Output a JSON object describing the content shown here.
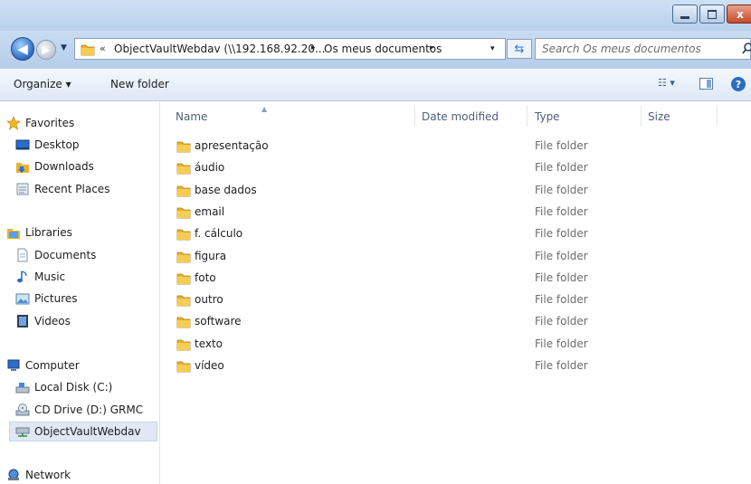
{
  "window": {
    "minimize_icon": "minimize-icon",
    "maximize_icon": "restore-icon",
    "close_label": "x"
  },
  "address": {
    "prefix": "«",
    "crumb_1": "ObjectVaultWebdav (\\\\192.168.92.20...",
    "separator": "▸",
    "crumb_2": "Os meus documentos",
    "dropdown": "▾"
  },
  "search": {
    "placeholder": "Search Os meus documentos"
  },
  "toolbar": {
    "organize_label": "Organize ▾",
    "new_folder_label": "New folder",
    "views_label": "☷ ▾",
    "help_label": "?"
  },
  "nav": {
    "favorites": {
      "label": "Favorites",
      "icon": "star-icon"
    },
    "favorites_items": [
      {
        "label": "Desktop",
        "icon": "desktop-icon"
      },
      {
        "label": "Downloads",
        "icon": "downloads-icon"
      },
      {
        "label": "Recent Places",
        "icon": "recent-places-icon"
      }
    ],
    "libraries": {
      "label": "Libraries",
      "icon": "libraries-icon"
    },
    "libraries_items": [
      {
        "label": "Documents",
        "icon": "documents-icon"
      },
      {
        "label": "Music",
        "icon": "music-icon"
      },
      {
        "label": "Pictures",
        "icon": "pictures-icon"
      },
      {
        "label": "Videos",
        "icon": "videos-icon"
      }
    ],
    "computer": {
      "label": "Computer",
      "icon": "computer-icon"
    },
    "computer_items": [
      {
        "label": "Local Disk (C:)",
        "icon": "local-disk-icon"
      },
      {
        "label": "CD Drive (D:) GRMC",
        "icon": "cd-drive-icon"
      },
      {
        "label": "ObjectVaultWebdav",
        "icon": "network-drive-icon",
        "selected": true
      }
    ],
    "network": {
      "label": "Network",
      "icon": "network-icon"
    }
  },
  "columns": {
    "name": "Name",
    "date_modified": "Date modified",
    "type": "Type",
    "size": "Size"
  },
  "files": [
    {
      "name": "apresentação",
      "type": "File folder"
    },
    {
      "name": "áudio",
      "type": "File folder"
    },
    {
      "name": "base dados",
      "type": "File folder"
    },
    {
      "name": "email",
      "type": "File folder"
    },
    {
      "name": "f. cálculo",
      "type": "File folder"
    },
    {
      "name": "figura",
      "type": "File folder"
    },
    {
      "name": "foto",
      "type": "File folder"
    },
    {
      "name": "outro",
      "type": "File folder"
    },
    {
      "name": "software",
      "type": "File folder"
    },
    {
      "name": "texto",
      "type": "File folder"
    },
    {
      "name": "vídeo",
      "type": "File folder"
    }
  ],
  "colors": {
    "titlebar": "#c2d7ef",
    "folder": "#e8b32c",
    "selection": "#dfe8f3"
  }
}
